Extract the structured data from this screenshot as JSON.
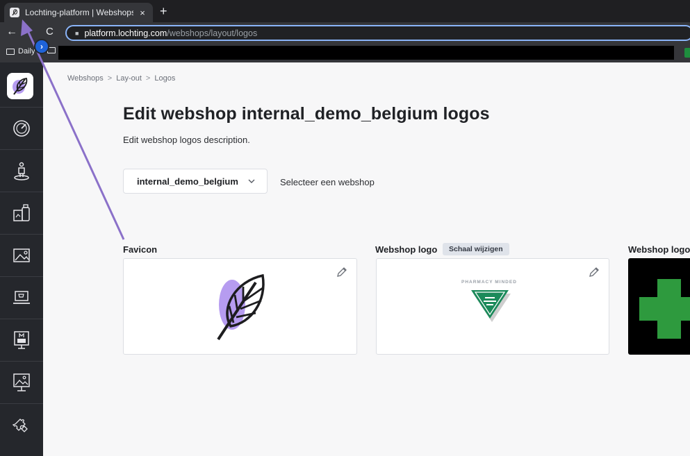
{
  "browser": {
    "tab_title": "Lochting-platform | Webshops",
    "tab_close": "×",
    "new_tab": "+",
    "back": "←",
    "reload": "C",
    "url_host": "platform.lochting.com",
    "url_path": "/webshops/layout/logos",
    "bookmarks": [
      {
        "label": "Daily"
      }
    ]
  },
  "sidebar": {
    "items": [
      {
        "icon": "dashboard-gauge-icon"
      },
      {
        "icon": "customer-icon"
      },
      {
        "icon": "products-icon"
      },
      {
        "icon": "media-icon"
      },
      {
        "icon": "webshop-cart-icon"
      },
      {
        "icon": "screen-m-icon"
      },
      {
        "icon": "presentation-icon"
      },
      {
        "icon": "puzzle-icon"
      }
    ],
    "expand_label": "›"
  },
  "breadcrumb": [
    "Webshops",
    "Lay-out",
    "Logos"
  ],
  "breadcrumb_separator": ">",
  "page": {
    "title": "Edit webshop internal_demo_belgium logos",
    "description": "Edit webshop logos description."
  },
  "webshop_select": {
    "value": "internal_demo_belgium",
    "label": "Selecteer een webshop"
  },
  "cards": {
    "favicon_label": "Favicon",
    "webshop_logo_label": "Webshop logo",
    "scale_badge": "Schaal wijzigen",
    "webshop_logo_2_label": "Webshop logo",
    "pharmacy_text": "PHARMACY MINDED"
  },
  "colors": {
    "sidebar_bg": "#25272c",
    "accent_blue": "#1f63d8",
    "annotation_arrow": "#8b71c9",
    "leaf_purple": "#b69cf0",
    "pharmacy_green": "#1b8a5a",
    "cross_green": "#2e9a3e"
  }
}
